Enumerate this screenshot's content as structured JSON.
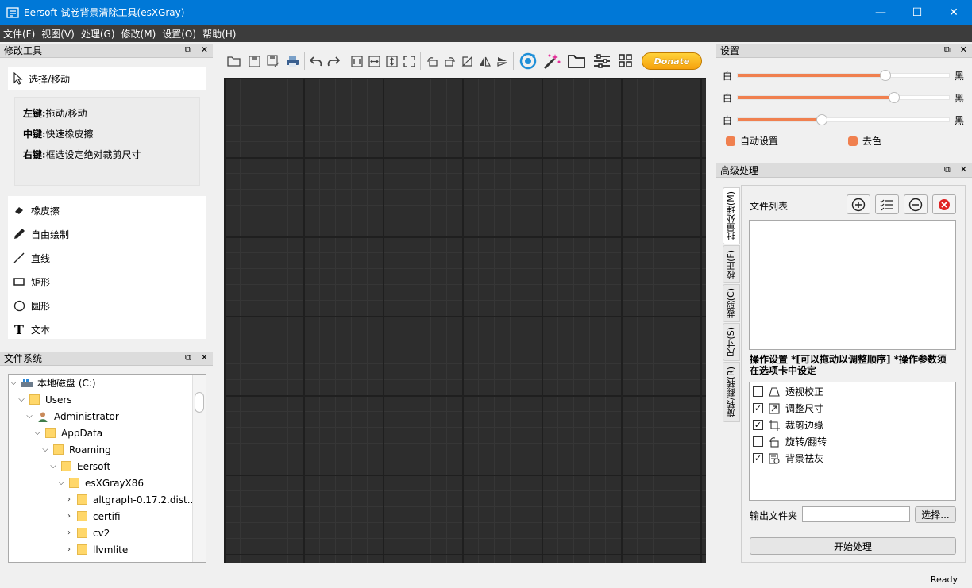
{
  "window": {
    "title": "Eersoft-试卷背景清除工具(esXGray)",
    "minimize": "—",
    "maximize": "☐",
    "close": "✕"
  },
  "menu": [
    "文件(F)",
    "视图(V)",
    "处理(G)",
    "修改(M)",
    "设置(O)",
    "帮助(H)"
  ],
  "modify_tools": {
    "header": "修改工具",
    "select_label": "选择/移动",
    "hints": [
      {
        "key": "左键:",
        "text": "拖动/移动"
      },
      {
        "key": "中键:",
        "text": "快速橡皮擦"
      },
      {
        "key": "右键:",
        "text": "框选设定绝对裁剪尺寸"
      }
    ],
    "tools": [
      "橡皮擦",
      "自由绘制",
      "直线",
      "矩形",
      "圆形",
      "文本"
    ]
  },
  "filesystem": {
    "header": "文件系统",
    "items": [
      {
        "label": "本地磁盘 (C:)",
        "arrow": "down"
      },
      {
        "label": "Users",
        "arrow": "down"
      },
      {
        "label": "Administrator",
        "arrow": "down"
      },
      {
        "label": "AppData",
        "arrow": "down"
      },
      {
        "label": "Roaming",
        "arrow": "down"
      },
      {
        "label": "Eersoft",
        "arrow": "down"
      },
      {
        "label": "esXGrayX86",
        "arrow": "down"
      },
      {
        "label": "altgraph-0.17.2.dist...",
        "arrow": "right"
      },
      {
        "label": "certifi",
        "arrow": "right"
      },
      {
        "label": "cv2",
        "arrow": "right"
      },
      {
        "label": "llvmlite",
        "arrow": "right"
      }
    ]
  },
  "toolbar": {
    "donate_label": "Donate"
  },
  "settings": {
    "header": "设置",
    "sliders": [
      {
        "left": "白",
        "right": "黑",
        "value": 0.7
      },
      {
        "left": "白",
        "right": "黑",
        "value": 0.74
      },
      {
        "left": "白",
        "right": "黑",
        "value": 0.4
      }
    ],
    "auto_label": "自动设置",
    "decolor_label": "去色",
    "accent": "#f0804f"
  },
  "advanced": {
    "header": "高级处理",
    "tabs": [
      "批量处理(M)",
      "校正(F)",
      "裁剪(C)",
      "尺寸(S)",
      "旋转/翻转(R)"
    ],
    "file_list_label": "文件列表",
    "op_settings_text": "操作设置 *[可以拖动以调整顺序] *操作参数须在选项卡中设定",
    "operations": [
      {
        "label": "透视校正",
        "checked": false
      },
      {
        "label": "调整尺寸",
        "checked": true
      },
      {
        "label": "裁剪边缘",
        "checked": true
      },
      {
        "label": "旋转/翻转",
        "checked": false
      },
      {
        "label": "背景祛灰",
        "checked": true
      }
    ],
    "output_label": "输出文件夹",
    "output_value": "",
    "browse_label": "选择...",
    "start_label": "开始处理"
  },
  "status": "Ready"
}
